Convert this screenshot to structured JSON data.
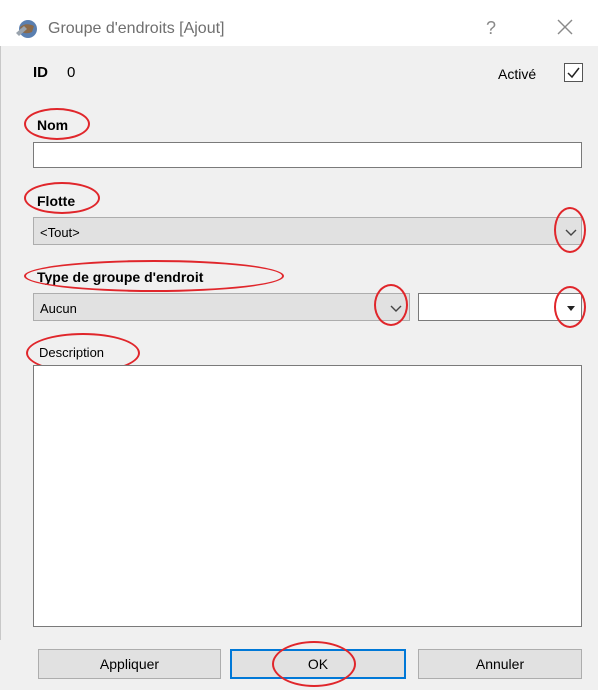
{
  "window": {
    "title": "Groupe d'endroits [Ajout]",
    "help_label": "?",
    "app_icon": "globe-app-icon",
    "close_icon": "close-icon"
  },
  "form": {
    "id_label": "ID",
    "id_value": "0",
    "active_label": "Activé",
    "active_checked": true,
    "name_label": "Nom",
    "name_value": "",
    "fleet_label": "Flotte",
    "fleet_value": "<Tout>",
    "type_label": "Type de groupe d'endroit",
    "type_value": "Aucun",
    "type_secondary_value": "",
    "description_label": "Description",
    "description_value": ""
  },
  "buttons": {
    "apply": "Appliquer",
    "ok": "OK",
    "cancel": "Annuler"
  },
  "colors": {
    "highlight_ring": "#e0262b",
    "default_button_border": "#0078d7"
  }
}
